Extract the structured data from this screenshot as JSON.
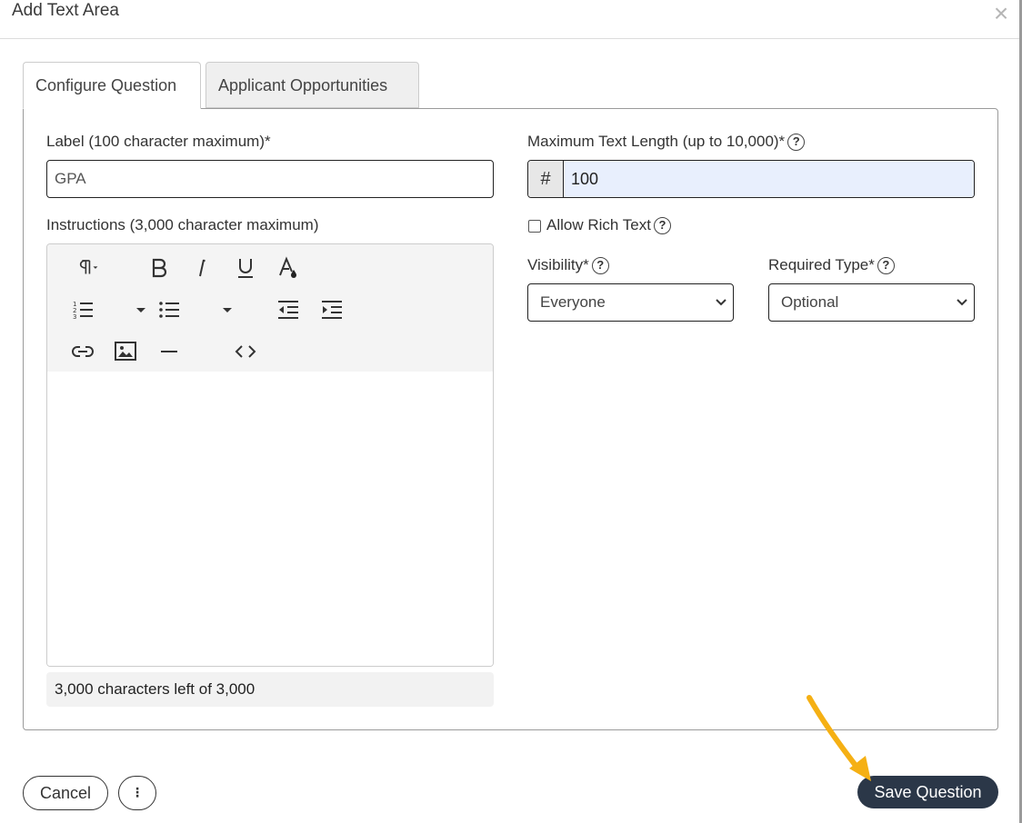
{
  "modal": {
    "title": "Add Text Area",
    "close_symbol": "×"
  },
  "tabs": [
    {
      "label": "Configure Question",
      "active": true
    },
    {
      "label": "Applicant Opportunities",
      "active": false
    }
  ],
  "form": {
    "label_field": {
      "label": "Label (100 character maximum)*",
      "value": "GPA"
    },
    "max_length_field": {
      "label": "Maximum Text Length (up to 10,000)*",
      "prefix": "#",
      "value": "100"
    },
    "instructions_field": {
      "label": "Instructions (3,000 character maximum)",
      "char_count": "3,000 characters left of 3,000"
    },
    "rich_text": {
      "label": "Allow Rich Text",
      "checked": false
    },
    "visibility": {
      "label": "Visibility*",
      "value": "Everyone"
    },
    "required_type": {
      "label": "Required Type*",
      "value": "Optional"
    },
    "help_symbol": "?"
  },
  "toolbar_icons": [
    "paragraph-icon",
    "bold-icon",
    "italic-icon",
    "underline-icon",
    "text-color-icon",
    "ordered-list-icon",
    "unordered-list-icon",
    "outdent-icon",
    "indent-icon",
    "link-icon",
    "image-icon",
    "horizontal-rule-icon",
    "code-view-icon"
  ],
  "footer": {
    "cancel_label": "Cancel",
    "more_label": "⋮",
    "save_label": "Save Question"
  },
  "colors": {
    "save_button": "#2b3748",
    "number_input_bg": "#e8effd",
    "annotation_arrow": "#f5b014"
  }
}
